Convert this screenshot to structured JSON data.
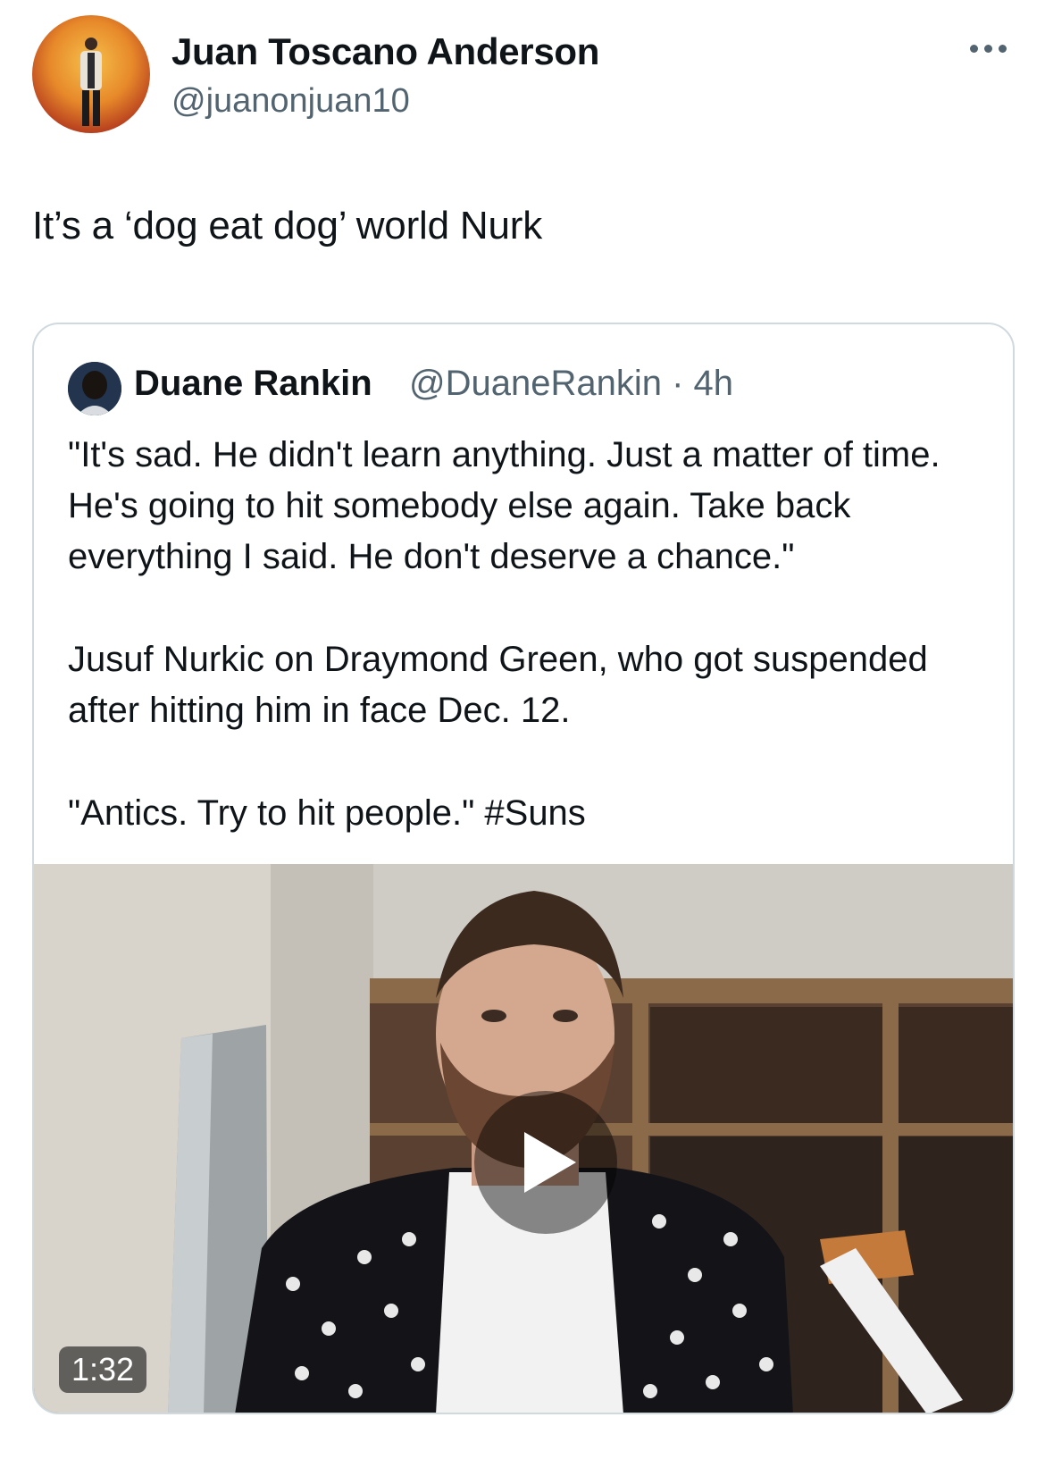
{
  "author": {
    "display_name": "Juan Toscano Anderson",
    "handle": "@juanonjuan10"
  },
  "tweet": {
    "text": "It’s a ‘dog eat dog’ world Nurk"
  },
  "more_icon": "ellipsis-icon",
  "quoted_tweet": {
    "display_name": "Duane Rankin",
    "handle_time": "@DuaneRankin · 4h",
    "paragraph_1": "\"It's sad. He didn't learn anything. Just a matter of time. He's going to hit somebody else again. Take back everything I said. He don't deserve a chance.\"",
    "paragraph_2": "Jusuf Nurkic on Draymond Green, who got suspended after hitting him in face Dec. 12.",
    "paragraph_3": "\"Antics. Try to hit people.\" #Suns",
    "video": {
      "duration": "1:32",
      "play_icon": "play-icon"
    }
  },
  "colors": {
    "text_primary": "#0f1419",
    "text_secondary": "#536471",
    "border": "#cfd9de"
  }
}
